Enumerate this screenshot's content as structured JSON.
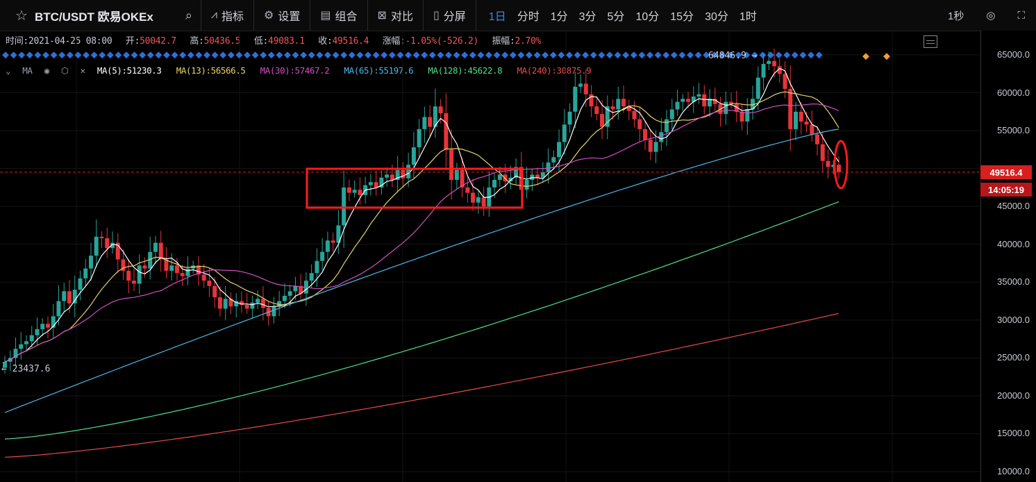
{
  "toolbar": {
    "symbol": "BTC/USDT 欧易OKEx",
    "items": [
      {
        "icon": "indicator-icon",
        "label": "指标"
      },
      {
        "icon": "settings-icon",
        "label": "设置"
      },
      {
        "icon": "layout-icon",
        "label": "组合"
      },
      {
        "icon": "compare-icon",
        "label": "对比"
      },
      {
        "icon": "split-icon",
        "label": "分屏"
      }
    ],
    "intervals": [
      "1日",
      "分时",
      "1分",
      "3分",
      "5分",
      "10分",
      "15分",
      "30分",
      "1时"
    ],
    "active_interval": "1日",
    "right_label": "1秒"
  },
  "ohlc": {
    "time_label": "时间:",
    "time": "2021-04-25 08:00",
    "open_label": "开:",
    "open": "50042.7",
    "high_label": "高:",
    "high": "50436.5",
    "low_label": "低:",
    "low": "49083.1",
    "close_label": "收:",
    "close": "49516.4",
    "change_label": "涨幅:",
    "change": "-1.05%(-526.2)",
    "amp_label": "振幅:",
    "amp": "2.70%"
  },
  "ma_legend": {
    "name": "MA",
    "items": [
      {
        "label": "MA(5):51230.3",
        "color": "#ffffff"
      },
      {
        "label": "MA(13):56566.5",
        "color": "#e8d56a"
      },
      {
        "label": "MA(30):57467.2",
        "color": "#d44fc4"
      },
      {
        "label": "MA(65):55197.6",
        "color": "#4fb8e8"
      },
      {
        "label": "MA(128):45622.8",
        "color": "#4ee08a"
      },
      {
        "label": "MA(240):30875.9",
        "color": "#e84a4a"
      }
    ]
  },
  "colors": {
    "up": "#26a69a",
    "down": "#e8333a",
    "bg": "#000000",
    "highlight": "#ff1a1a"
  },
  "chart_data": {
    "type": "candlestick",
    "y_axis_ticks": [
      "65000.0",
      "60000.0",
      "55000.0",
      "50000.0",
      "45000.0",
      "40000.0",
      "35000.0",
      "30000.0",
      "25000.0",
      "20000.0",
      "15000.0",
      "10000.0"
    ],
    "ylim": [
      10000,
      67000
    ],
    "last_price": "49516.4",
    "countdown": "14:05:19",
    "high_marker": "64846.9",
    "low_marker": "23437.6",
    "ma_end_values": {
      "ma5": 51230.3,
      "ma13": 56566.5,
      "ma30": 57467.2,
      "ma65": 55197.6,
      "ma128": 45622.8,
      "ma240": 30875.9
    },
    "closes": [
      24500,
      25000,
      26200,
      26800,
      27200,
      28000,
      28800,
      29500,
      29000,
      30500,
      32500,
      33800,
      32200,
      34000,
      35500,
      36800,
      38500,
      41000,
      40800,
      39500,
      40200,
      38000,
      36500,
      35200,
      34800,
      37200,
      36800,
      39000,
      40200,
      38000,
      36500,
      37200,
      36200,
      35800,
      36800,
      37200,
      36000,
      35200,
      34500,
      33000,
      31500,
      32800,
      31800,
      32500,
      32000,
      31500,
      32300,
      32800,
      31600,
      30500,
      31800,
      32500,
      33200,
      33800,
      34500,
      33500,
      35200,
      36200,
      37800,
      39000,
      40500,
      40200,
      42500,
      47500,
      46800,
      47200,
      46500,
      47800,
      48200,
      47500,
      48800,
      49200,
      48500,
      49800,
      48700,
      50500,
      52800,
      55200,
      56800,
      55500,
      58200,
      57300,
      52500,
      48500,
      49800,
      47500,
      46800,
      45500,
      46200,
      45000,
      47500,
      48500,
      49200,
      48300,
      48800,
      50200,
      47200,
      48500,
      49200,
      48800,
      49500,
      50800,
      51500,
      53500,
      55800,
      57500,
      60800,
      61200,
      59800,
      58200,
      57200,
      55500,
      58200,
      57800,
      59200,
      58200,
      57600,
      56500,
      55200,
      53800,
      52200,
      53500,
      54800,
      56500,
      57800,
      58800,
      59200,
      58800,
      59500,
      59800,
      58200,
      59200,
      58500,
      57200,
      58800,
      58500,
      57500,
      56200,
      57800,
      59200,
      62000,
      63800,
      64200,
      63500,
      62500,
      60500,
      55200,
      57500,
      56200,
      55800,
      54500,
      53200,
      51000,
      50200,
      50500,
      49516
    ]
  }
}
